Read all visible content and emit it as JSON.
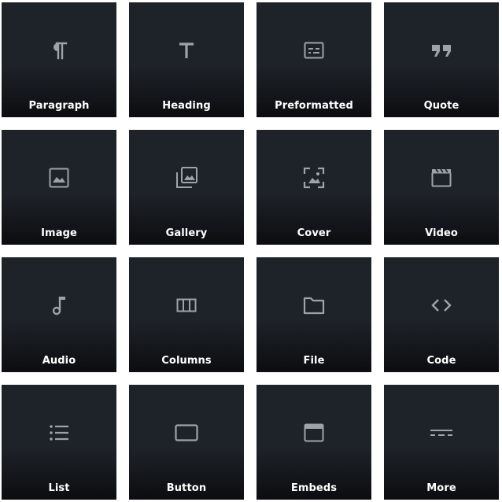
{
  "colors": {
    "tile_top": "#1e2229",
    "tile_bottom": "#0b0d10",
    "icon": "#9ea3a9",
    "label": "#ffffff"
  },
  "blocks": [
    {
      "label": "Paragraph",
      "icon": "paragraph-icon"
    },
    {
      "label": "Heading",
      "icon": "heading-icon"
    },
    {
      "label": "Preformatted",
      "icon": "preformatted-icon"
    },
    {
      "label": "Quote",
      "icon": "quote-icon"
    },
    {
      "label": "Image",
      "icon": "image-icon"
    },
    {
      "label": "Gallery",
      "icon": "gallery-icon"
    },
    {
      "label": "Cover",
      "icon": "cover-icon"
    },
    {
      "label": "Video",
      "icon": "video-icon"
    },
    {
      "label": "Audio",
      "icon": "audio-icon"
    },
    {
      "label": "Columns",
      "icon": "columns-icon"
    },
    {
      "label": "File",
      "icon": "file-icon"
    },
    {
      "label": "Code",
      "icon": "code-icon"
    },
    {
      "label": "List",
      "icon": "list-icon"
    },
    {
      "label": "Button",
      "icon": "button-icon"
    },
    {
      "label": "Embeds",
      "icon": "embeds-icon"
    },
    {
      "label": "More",
      "icon": "more-icon"
    }
  ]
}
